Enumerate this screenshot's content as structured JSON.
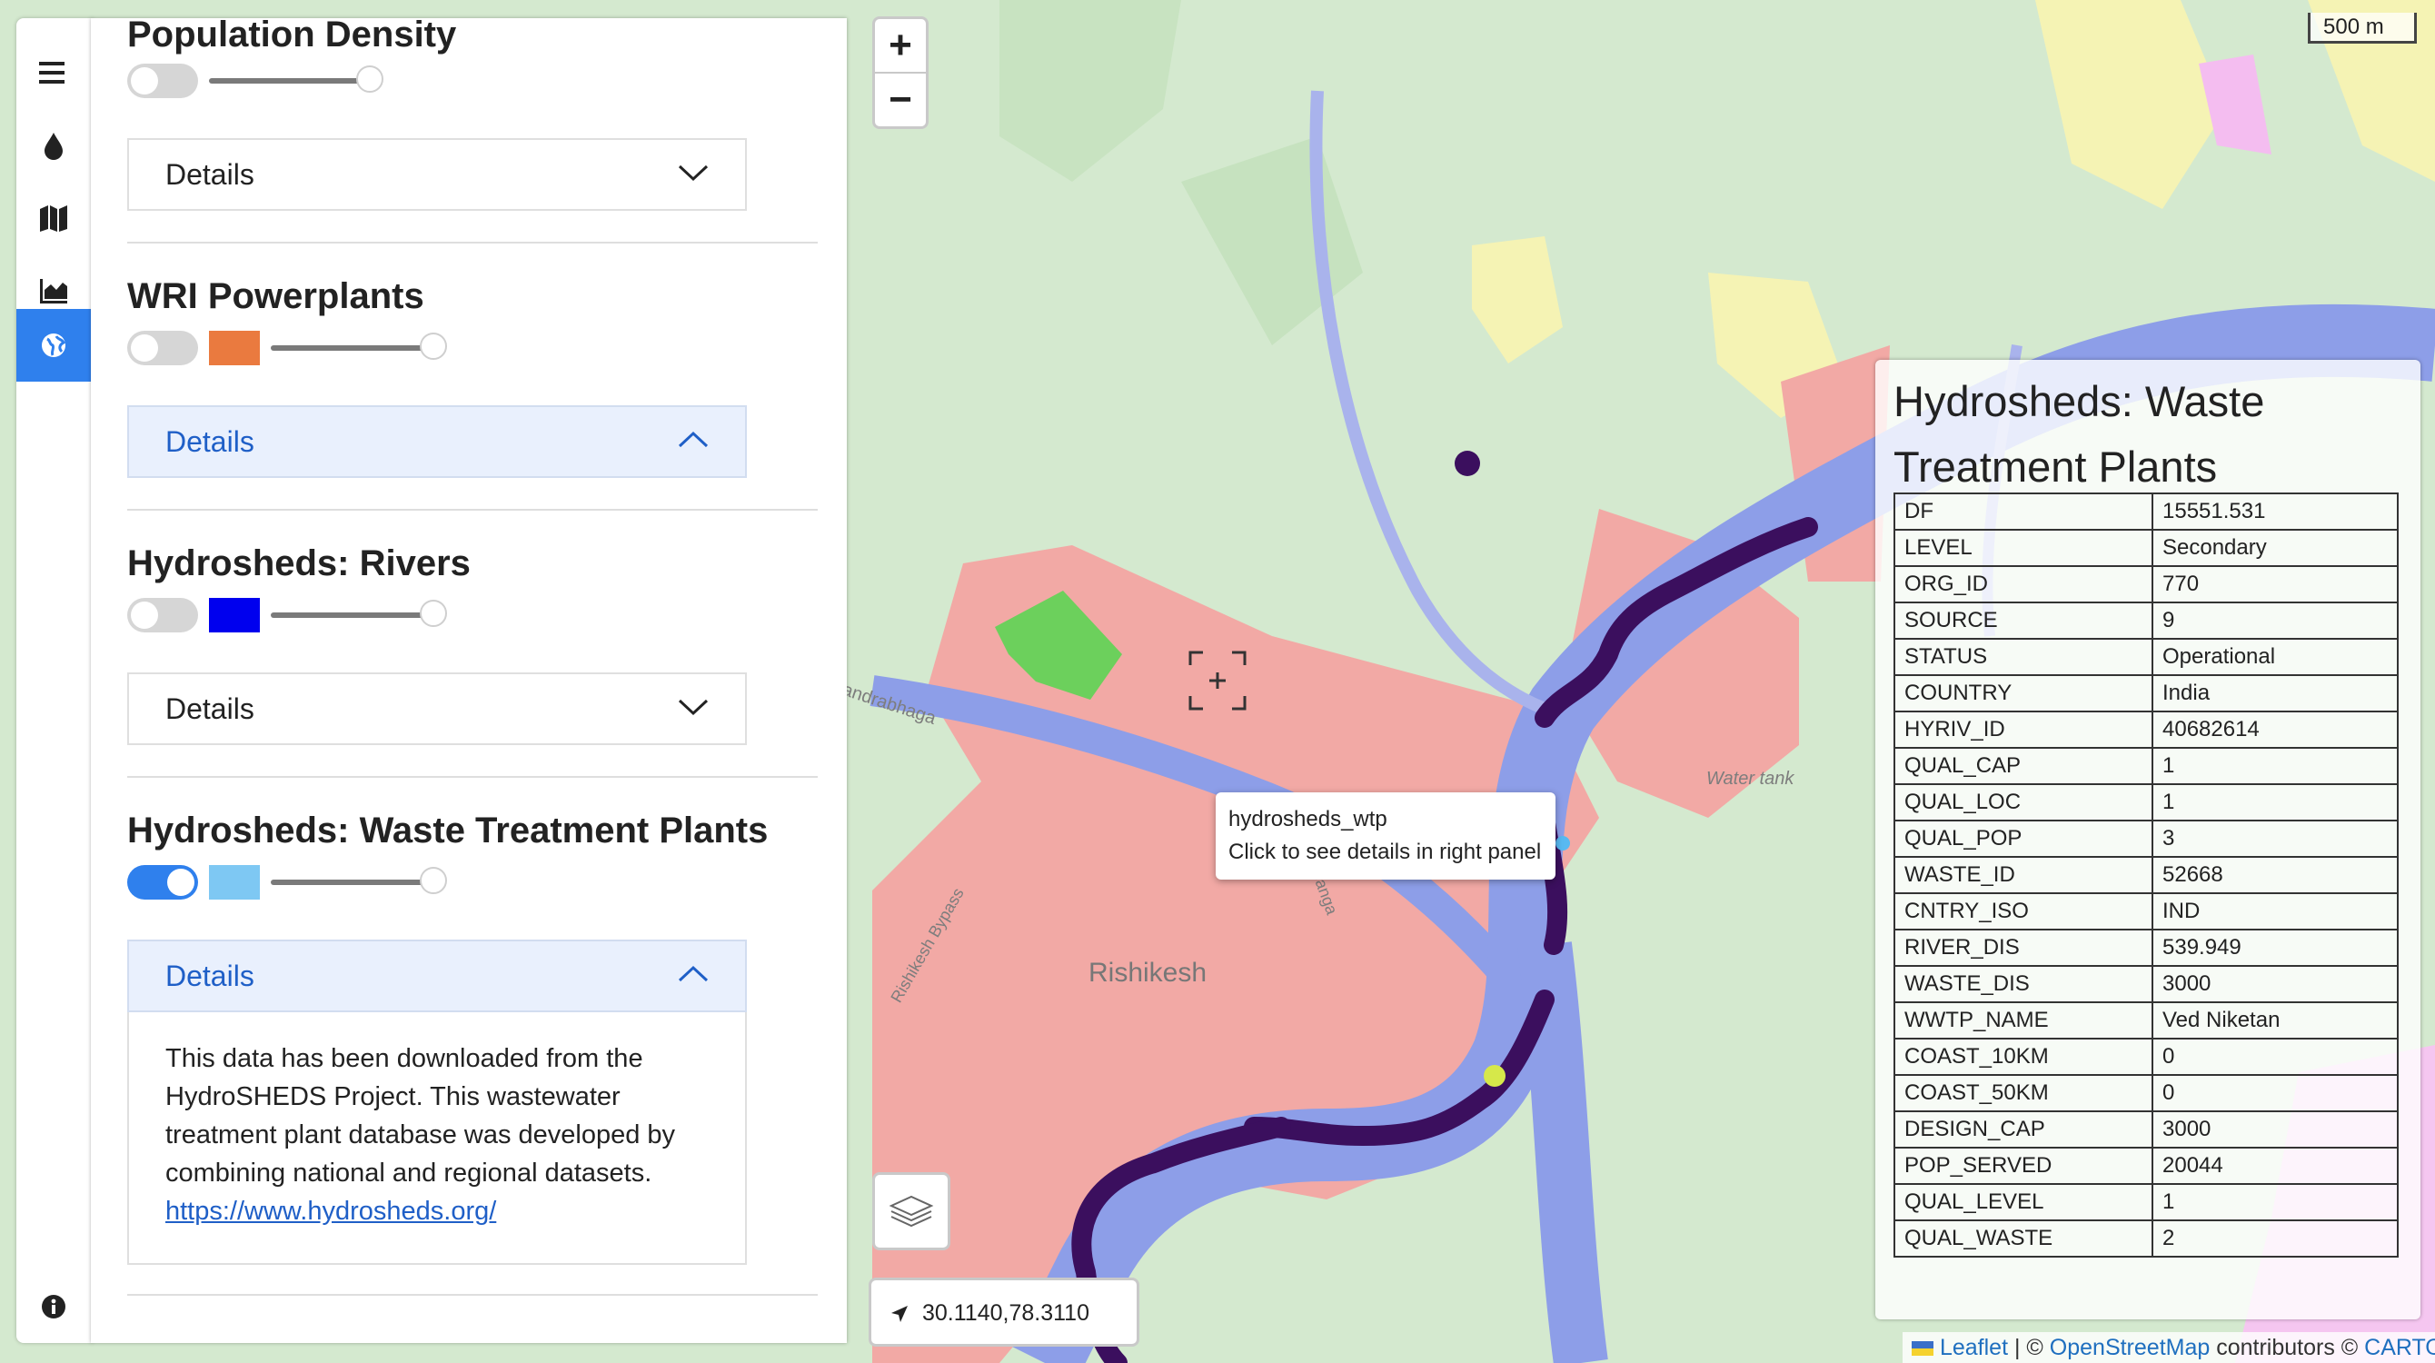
{
  "layers": [
    {
      "title": "Population Density",
      "enabled": false,
      "details_label": "Details",
      "details_open": false
    },
    {
      "title": "WRI Powerplants",
      "enabled": false,
      "color": "#ea7a3f",
      "details_label": "Details",
      "details_open": true
    },
    {
      "title": "Hydrosheds: Rivers",
      "enabled": false,
      "color": "#0000ee",
      "details_label": "Details",
      "details_open": false
    },
    {
      "title": "Hydrosheds: Waste Treatment Plants",
      "enabled": true,
      "color": "#7ec8f3",
      "details_label": "Details",
      "details_open": true,
      "description": "This data has been downloaded from the HydroSHEDS Project. This wastewater treatment plant database was developed by combining national and regional datasets.",
      "link": "https://www.hydrosheds.org/"
    }
  ],
  "sidebar_icons": [
    "menu-icon",
    "water-drop-icon",
    "map-icon",
    "industry-icon",
    "globe-icon",
    "info-icon"
  ],
  "map": {
    "zoom_in": "+",
    "zoom_out": "−",
    "scale_label": "500 m",
    "coordinates": "30.1140,78.3110",
    "labels": {
      "city": "Rishikesh",
      "water_tank": "Water tank",
      "river": "Chandrabhaga",
      "road": "Rishikesh Bypass",
      "road2": "Ganga"
    },
    "tooltip": {
      "title": "hydrosheds_wtp",
      "subtitle": "Click to see details in right panel"
    }
  },
  "info_panel": {
    "title": "Hydrosheds: Waste Treatment Plants",
    "rows": [
      {
        "key": "DF",
        "value": "15551.531"
      },
      {
        "key": "LEVEL",
        "value": "Secondary"
      },
      {
        "key": "ORG_ID",
        "value": "770"
      },
      {
        "key": "SOURCE",
        "value": "9"
      },
      {
        "key": "STATUS",
        "value": "Operational"
      },
      {
        "key": "COUNTRY",
        "value": "India"
      },
      {
        "key": "HYRIV_ID",
        "value": "40682614"
      },
      {
        "key": "QUAL_CAP",
        "value": "1"
      },
      {
        "key": "QUAL_LOC",
        "value": "1"
      },
      {
        "key": "QUAL_POP",
        "value": "3"
      },
      {
        "key": "WASTE_ID",
        "value": "52668"
      },
      {
        "key": "CNTRY_ISO",
        "value": "IND"
      },
      {
        "key": "RIVER_DIS",
        "value": "539.949"
      },
      {
        "key": "WASTE_DIS",
        "value": "3000"
      },
      {
        "key": "WWTP_NAME",
        "value": "Ved Niketan"
      },
      {
        "key": "COAST_10KM",
        "value": "0"
      },
      {
        "key": "COAST_50KM",
        "value": "0"
      },
      {
        "key": "DESIGN_CAP",
        "value": "3000"
      },
      {
        "key": "POP_SERVED",
        "value": "20044"
      },
      {
        "key": "QUAL_LEVEL",
        "value": "1"
      },
      {
        "key": "QUAL_WASTE",
        "value": "2"
      }
    ]
  },
  "attribution": {
    "leaflet": "Leaflet",
    "sep": " | © ",
    "osm": "OpenStreetMap",
    "contrib": " contributors © ",
    "carto": "CARTO"
  },
  "colors": {
    "accent": "#2f80ed",
    "urban": "#f2a9a5",
    "river": "#8d9ee8",
    "wtp_line": "#3b0f5e"
  }
}
